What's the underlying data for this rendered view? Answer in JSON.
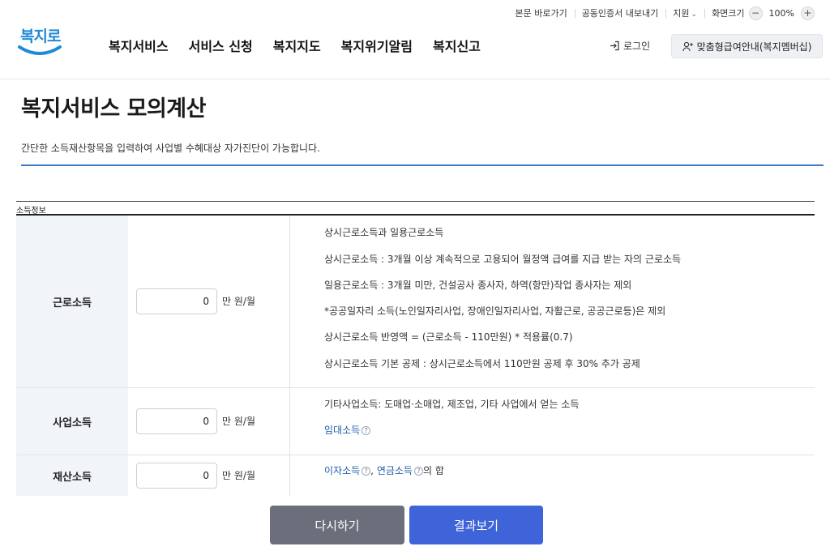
{
  "utility": {
    "skip_link": "본문 바로가기",
    "cert_export": "공동인증서 내보내기",
    "support": "지원",
    "screen_size": "화면크기",
    "zoom_minus": "−",
    "zoom_value": "100%",
    "zoom_plus": "+"
  },
  "logo": {
    "text": "복지로"
  },
  "nav": {
    "items": [
      "복지서비스",
      "서비스 신청",
      "복지지도",
      "복지위기알림",
      "복지신고"
    ]
  },
  "header": {
    "login": "로그인",
    "member_button": "맞춤형급여안내(복지멤버십)"
  },
  "page": {
    "title": "복지서비스 모의계산",
    "description": "간단한 소득재산항목을 입력하여 사업별 수혜대상 자가진단이 가능합니다."
  },
  "section": {
    "label": "소득정보"
  },
  "rows": [
    {
      "label": "근로소득",
      "value": "0",
      "unit": "만 원/월",
      "info": [
        "상시근로소득과 일용근로소득",
        "상시근로소득 : 3개월 이상 계속적으로 고용되어 월정액 급여를 지급 받는 자의 근로소득",
        "일용근로소득 : 3개월 미만, 건설공사 종사자, 하역(항만)작업 종사자는 제외",
        "*공공일자리 소득(노인일자리사업, 장애인일자리사업, 자활근로, 공공근로등)은 제외",
        "상시근로소득 반영액 = (근로소득 - 110만원) * 적용률(0.7)",
        "상시근로소득 기본 공제 : 상시근로소득에서 110만원 공제 후 30% 추가 공제"
      ]
    },
    {
      "label": "사업소득",
      "value": "0",
      "unit": "만 원/월",
      "info": [
        "기타사업소득: 도매업·소매업, 제조업, 기타 사업에서 얻는 소득"
      ],
      "link": "임대소득"
    },
    {
      "label": "재산소득",
      "value": "0",
      "unit": "만 원/월",
      "link1": "이자소득",
      "link2": "연금소득",
      "suffix": "의 합"
    }
  ],
  "buttons": {
    "reset": "다시하기",
    "result": "결과보기"
  },
  "icons": {
    "login": "login-icon",
    "member": "user-plus-icon",
    "support_chevron": "chevron-down-icon",
    "help": "question-icon"
  },
  "colors": {
    "brand": "#1f8ad6",
    "accent_line": "#3d7bc4",
    "result_button": "#3f63d8",
    "reset_button": "#6b6f7c",
    "label_bg": "#f1f4f8"
  }
}
